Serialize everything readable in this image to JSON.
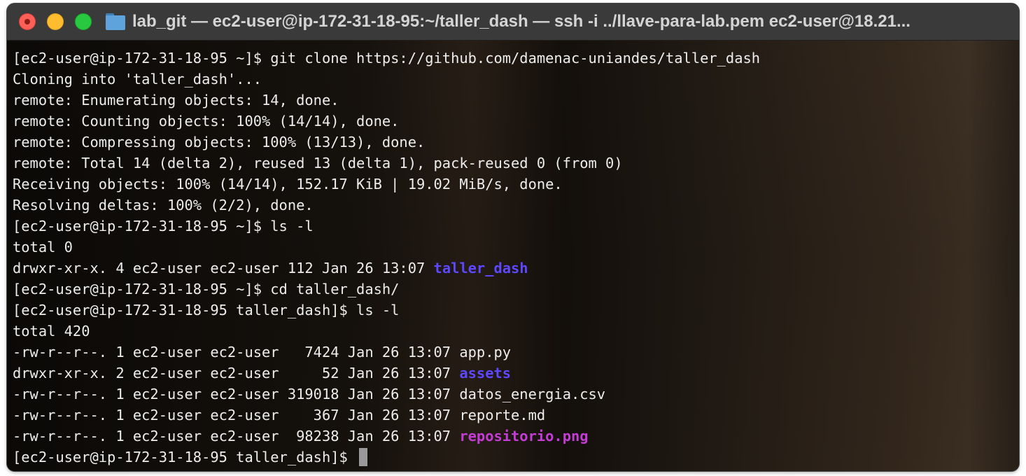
{
  "window": {
    "title": "lab_git — ec2-user@ip-172-31-18-95:~/taller_dash — ssh -i ../llave-para-lab.pem ec2-user@18.21..."
  },
  "colors": {
    "directory": "#5d47ff",
    "image_file": "#c43cd6",
    "text": "#ededed"
  },
  "terminal": {
    "lines": [
      "[ec2-user@ip-172-31-18-95 ~]$ git clone https://github.com/damenac-uniandes/taller_dash",
      "Cloning into 'taller_dash'...",
      "remote: Enumerating objects: 14, done.",
      "remote: Counting objects: 100% (14/14), done.",
      "remote: Compressing objects: 100% (13/13), done.",
      "remote: Total 14 (delta 2), reused 13 (delta 1), pack-reused 0 (from 0)",
      "Receiving objects: 100% (14/14), 152.17 KiB | 19.02 MiB/s, done.",
      "Resolving deltas: 100% (2/2), done.",
      "[ec2-user@ip-172-31-18-95 ~]$ ls -l",
      "total 0",
      {
        "prefix": "drwxr-xr-x. 4 ec2-user ec2-user 112 Jan 26 13:07 ",
        "name": "taller_dash",
        "kind": "dir"
      },
      "[ec2-user@ip-172-31-18-95 ~]$ cd taller_dash/",
      "[ec2-user@ip-172-31-18-95 taller_dash]$ ls -l",
      "total 420",
      {
        "prefix": "-rw-r--r--. 1 ec2-user ec2-user   7424 Jan 26 13:07 ",
        "name": "app.py",
        "kind": "file"
      },
      {
        "prefix": "drwxr-xr-x. 2 ec2-user ec2-user     52 Jan 26 13:07 ",
        "name": "assets",
        "kind": "dir"
      },
      {
        "prefix": "-rw-r--r--. 1 ec2-user ec2-user 319018 Jan 26 13:07 ",
        "name": "datos_energia.csv",
        "kind": "file"
      },
      {
        "prefix": "-rw-r--r--. 1 ec2-user ec2-user    367 Jan 26 13:07 ",
        "name": "reporte.md",
        "kind": "file"
      },
      {
        "prefix": "-rw-r--r--. 1 ec2-user ec2-user  98238 Jan 26 13:07 ",
        "name": "repositorio.png",
        "kind": "img"
      }
    ],
    "prompt": "[ec2-user@ip-172-31-18-95 taller_dash]$ "
  }
}
